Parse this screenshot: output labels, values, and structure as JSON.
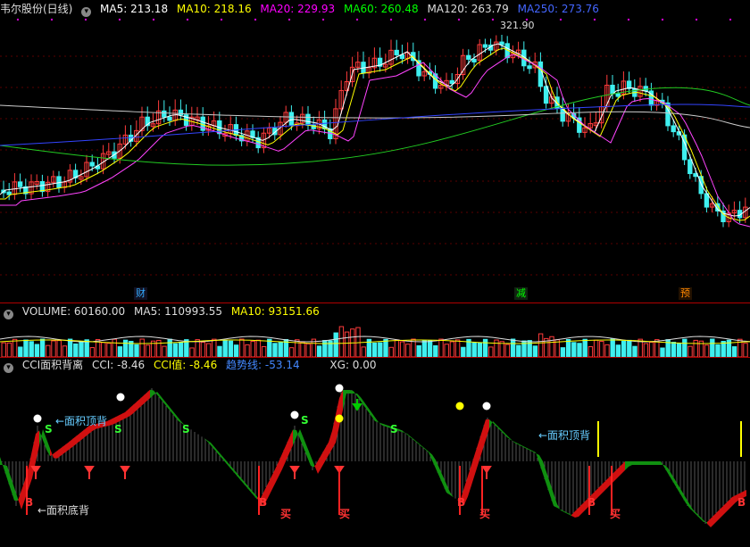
{
  "main": {
    "title": "韦尔股份(日线)",
    "ma": [
      {
        "label": "MA5: 213.18",
        "color": "#ffffff"
      },
      {
        "label": "MA10: 218.16",
        "color": "#ffff00"
      },
      {
        "label": "MA20: 229.93",
        "color": "#ff00ff"
      },
      {
        "label": "MA60: 260.48",
        "color": "#00ff00"
      },
      {
        "label": "MA120: 263.79",
        "color": "#cccccc"
      },
      {
        "label": "MA250: 273.76",
        "color": "#4444ff"
      }
    ],
    "high_label": "321.90",
    "markers": [
      {
        "text": "财",
        "color": "#00a0ff"
      },
      {
        "text": "减",
        "color": "#00ff00"
      },
      {
        "text": "预",
        "color": "#ff8800"
      }
    ]
  },
  "volume": {
    "title": "VOLUME: 60160.00",
    "ma5": "MA5: 110993.55",
    "ma10": "MA10: 93151.66"
  },
  "cci": {
    "title": "CCI面积背离",
    "cci": "CCI: -8.46",
    "cci_val": "CCI值: -8.46",
    "trend": "趋势线: -53.14",
    "xg": "XG: 0.00",
    "labels": {
      "top_div": "←面积顶背",
      "bottom_div": "←面积底背",
      "buy": "买",
      "b": "B",
      "s": "S"
    }
  },
  "colors": {
    "up": "#ff3b3b",
    "down": "#3ff0f0",
    "bg": "#000000",
    "grid": "#700000"
  }
}
